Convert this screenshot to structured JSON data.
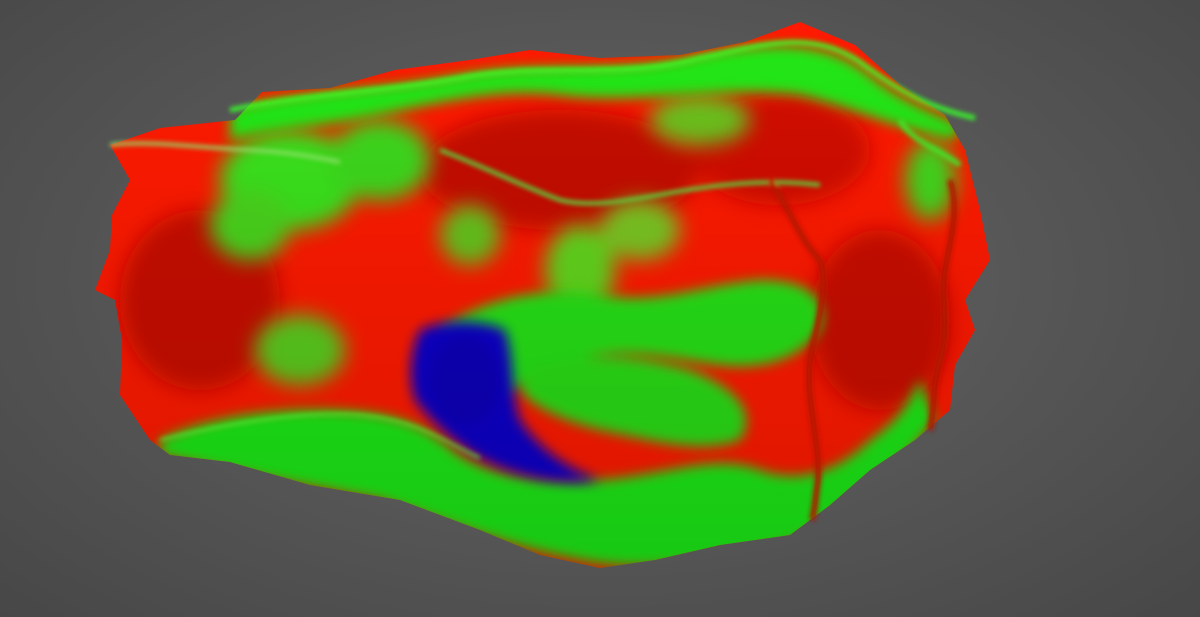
{
  "viewport": {
    "background_color": "#585858"
  },
  "model": {
    "colormap": {
      "high": "#ff1a00",
      "mid": "#19ff10",
      "low": "#0a00c8"
    },
    "edge_color": "#37ff2b"
  }
}
